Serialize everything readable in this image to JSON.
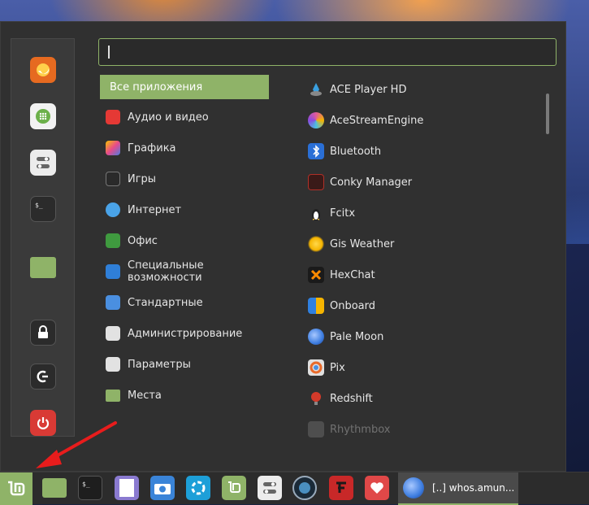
{
  "search": {
    "value": ""
  },
  "favorites": [
    {
      "name": "firefox-icon",
      "color": "#e66a20"
    },
    {
      "name": "software-manager-icon",
      "color": "#f2f2f2"
    },
    {
      "name": "system-settings-icon",
      "color": "#ececec"
    },
    {
      "name": "terminal-icon",
      "color": "#2b2b2b"
    },
    {
      "name": "files-folder-icon",
      "color": "#8fb368"
    },
    {
      "name": "lock-screen-icon",
      "color": "#2b2b2b"
    },
    {
      "name": "logout-icon",
      "color": "#2b2b2b"
    },
    {
      "name": "shutdown-icon",
      "color": "#d93a35"
    }
  ],
  "categories": [
    {
      "label": "Все приложения",
      "active": true
    },
    {
      "label": "Аудио и видео",
      "icon": "media-icon",
      "color": "#e53935"
    },
    {
      "label": "Графика",
      "icon": "graphics-icon",
      "color": "#c04ad0"
    },
    {
      "label": "Игры",
      "icon": "games-icon",
      "color": "#2a2a2a"
    },
    {
      "label": "Интернет",
      "icon": "internet-icon",
      "color": "#4aa3e8"
    },
    {
      "label": "Офис",
      "icon": "office-icon",
      "color": "#3f9a3f"
    },
    {
      "label": "Специальные возможности",
      "icon": "accessibility-icon",
      "color": "#2f7fd8"
    },
    {
      "label": "Стандартные",
      "icon": "accessories-icon",
      "color": "#4a8fe0"
    },
    {
      "label": "Администрирование",
      "icon": "administration-icon",
      "color": "#e2e2e2"
    },
    {
      "label": "Параметры",
      "icon": "preferences-icon",
      "color": "#e2e2e2"
    },
    {
      "label": "Места",
      "icon": "places-icon",
      "color": "#8fb368"
    }
  ],
  "apps": [
    {
      "label": "ACE Player HD",
      "icon": "ace-player-icon",
      "color": "#3aa0e0"
    },
    {
      "label": "AceStreamEngine",
      "icon": "acestream-icon",
      "color": "#e05a9a"
    },
    {
      "label": "Bluetooth",
      "icon": "bluetooth-icon",
      "color": "#2a6fd6"
    },
    {
      "label": "Conky Manager",
      "icon": "conky-icon",
      "color": "#b03028"
    },
    {
      "label": "Fcitx",
      "icon": "fcitx-icon",
      "color": "#f2c040"
    },
    {
      "label": "Gis Weather",
      "icon": "weather-icon",
      "color": "#f5b400"
    },
    {
      "label": "HexChat",
      "icon": "hexchat-icon",
      "color": "#ff8a00"
    },
    {
      "label": "Onboard",
      "icon": "onboard-icon",
      "color": "#2f80e0"
    },
    {
      "label": "Pale Moon",
      "icon": "pale-moon-icon",
      "color": "#3d7de0"
    },
    {
      "label": "Pix",
      "icon": "pix-icon",
      "color": "#e0e0e0"
    },
    {
      "label": "Redshift",
      "icon": "redshift-icon",
      "color": "#d23a2a"
    },
    {
      "label": "Rhythmbox",
      "icon": "rhythmbox-icon",
      "color": "#888888"
    }
  ],
  "taskbar": {
    "launchers": [
      "files-folder-icon",
      "terminal-icon",
      "text-editor-icon",
      "screenshot-icon",
      "acestream-icon",
      "mint-update-icon",
      "system-settings-icon",
      "speed-dial-icon",
      "font-manager-icon",
      "favorites-heart-icon"
    ],
    "window_title": "[..] whos.amun..."
  },
  "colors": {
    "accent": "#8fb368",
    "menu_bg": "#303030"
  }
}
